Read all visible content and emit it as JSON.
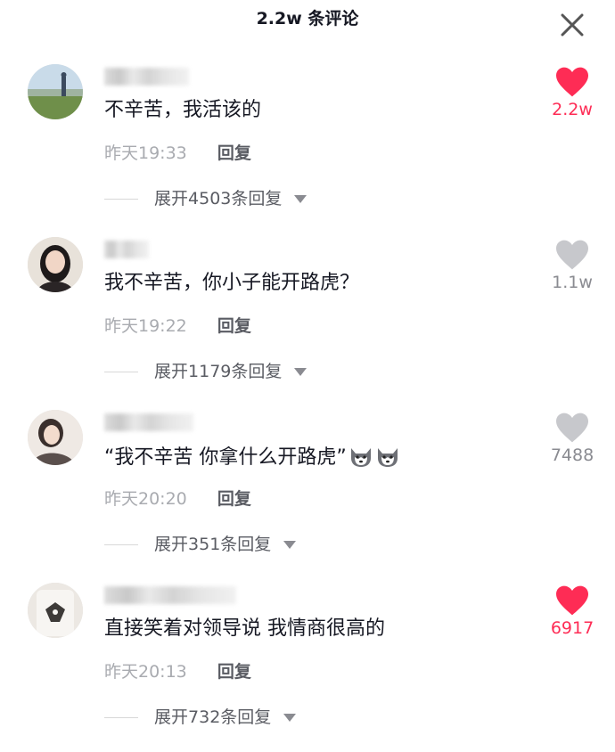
{
  "header": {
    "title": "2.2w 条评论"
  },
  "colors": {
    "liked": "#fe2c55",
    "unliked": "#c7c8cc",
    "count_liked": "#fe2c55",
    "count_unliked": "#8a8b91"
  },
  "comments": [
    {
      "text": "不辛苦，我活该的",
      "time": "昨天19:33",
      "reply_label": "回复",
      "expand_label": "展开4503条回复",
      "like_count": "2.2w",
      "liked": true
    },
    {
      "text": "我不辛苦，你小子能开路虎？",
      "time": "昨天19:22",
      "reply_label": "回复",
      "expand_label": "展开1179条回复",
      "like_count": "1.1w",
      "liked": false
    },
    {
      "text": "“我不辛苦 你拿什么开路虎”",
      "time": "昨天20:20",
      "reply_label": "回复",
      "expand_label": "展开351条回复",
      "like_count": "7488",
      "liked": false
    },
    {
      "text": "直接笑着对领导说 我情商很高的",
      "time": "昨天20:13",
      "reply_label": "回复",
      "expand_label": "展开732条回复",
      "like_count": "6917",
      "liked": true
    }
  ]
}
